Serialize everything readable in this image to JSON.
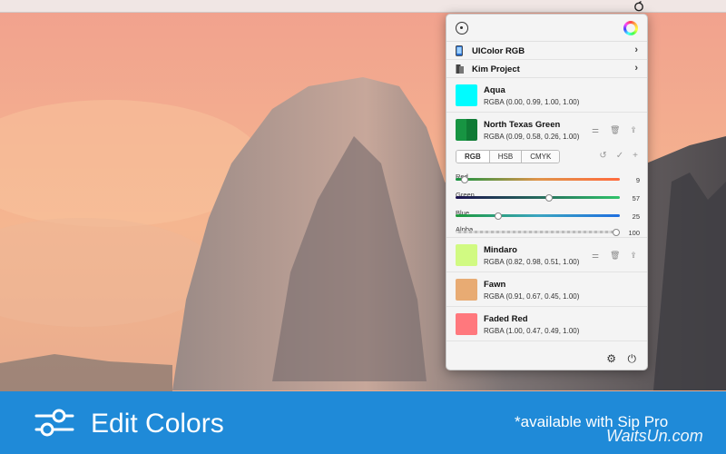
{
  "menubar": {
    "apple_glyph": ""
  },
  "panel": {
    "nav": [
      {
        "label": "UIColor RGB",
        "icon": "phone-icon"
      },
      {
        "label": "Kim Project",
        "icon": "palette-icon"
      }
    ],
    "colors": [
      {
        "name": "Aqua",
        "value": "RGBA (0.00, 0.99, 1.00, 1.00)",
        "hex": "#00fcff"
      },
      {
        "name": "North Texas Green",
        "value": "RGBA (0.09, 0.58, 0.26, 1.00)",
        "hex": "#179442"
      },
      {
        "name": "Mindaro",
        "value": "RGBA (0.82, 0.98, 0.51, 1.00)",
        "hex": "#d1fa82"
      },
      {
        "name": "Fawn",
        "value": "RGBA (0.91, 0.67, 0.45, 1.00)",
        "hex": "#e8ab73"
      },
      {
        "name": "Faded Red",
        "value": "RGBA (1.00, 0.47, 0.49, 1.00)",
        "hex": "#ff787d"
      }
    ],
    "editor": {
      "modes": [
        "RGB",
        "HSB",
        "CMYK"
      ],
      "active_mode": "RGB",
      "sliders": [
        {
          "label": "Red",
          "value": "9",
          "fraction": 0.035
        },
        {
          "label": "Green",
          "value": "57",
          "fraction": 0.57
        },
        {
          "label": "Blue",
          "value": "25",
          "fraction": 0.25
        },
        {
          "label": "Alpha",
          "value": "100",
          "fraction": 1.0
        }
      ]
    }
  },
  "banner": {
    "title": "Edit Colors",
    "note": "*available with Sip Pro",
    "watermark": "WaitsUn.com"
  }
}
